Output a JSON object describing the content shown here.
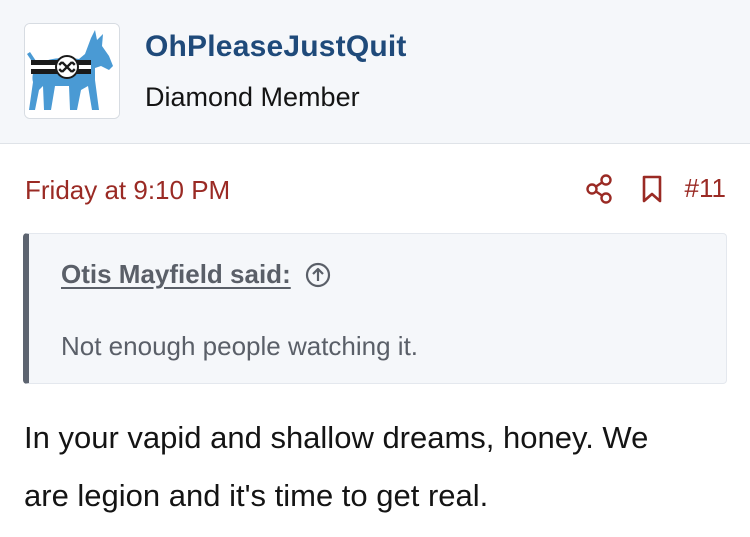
{
  "user": {
    "name": "OhPleaseJustQuit",
    "title": "Diamond Member",
    "avatar_icon": "donkey-flag-avatar-icon"
  },
  "post": {
    "date": "Friday at 9:10 PM",
    "number": "#11",
    "share_icon": "share-icon",
    "bookmark_icon": "bookmark-icon",
    "quote": {
      "author": "Otis Mayfield said:",
      "jump_icon": "arrow-up-circle-icon",
      "text": "Not enough people watching it."
    },
    "body_line1": "In your vapid and shallow dreams, honey. We",
    "body_line2": "are legion and it's time to get real."
  },
  "colors": {
    "header_bg": "#f5f7fa",
    "username": "#1f4a7a",
    "date_accent": "#9a2a24",
    "quote_bar": "#5d6470",
    "avatar_blue": "#4a9ad4"
  }
}
